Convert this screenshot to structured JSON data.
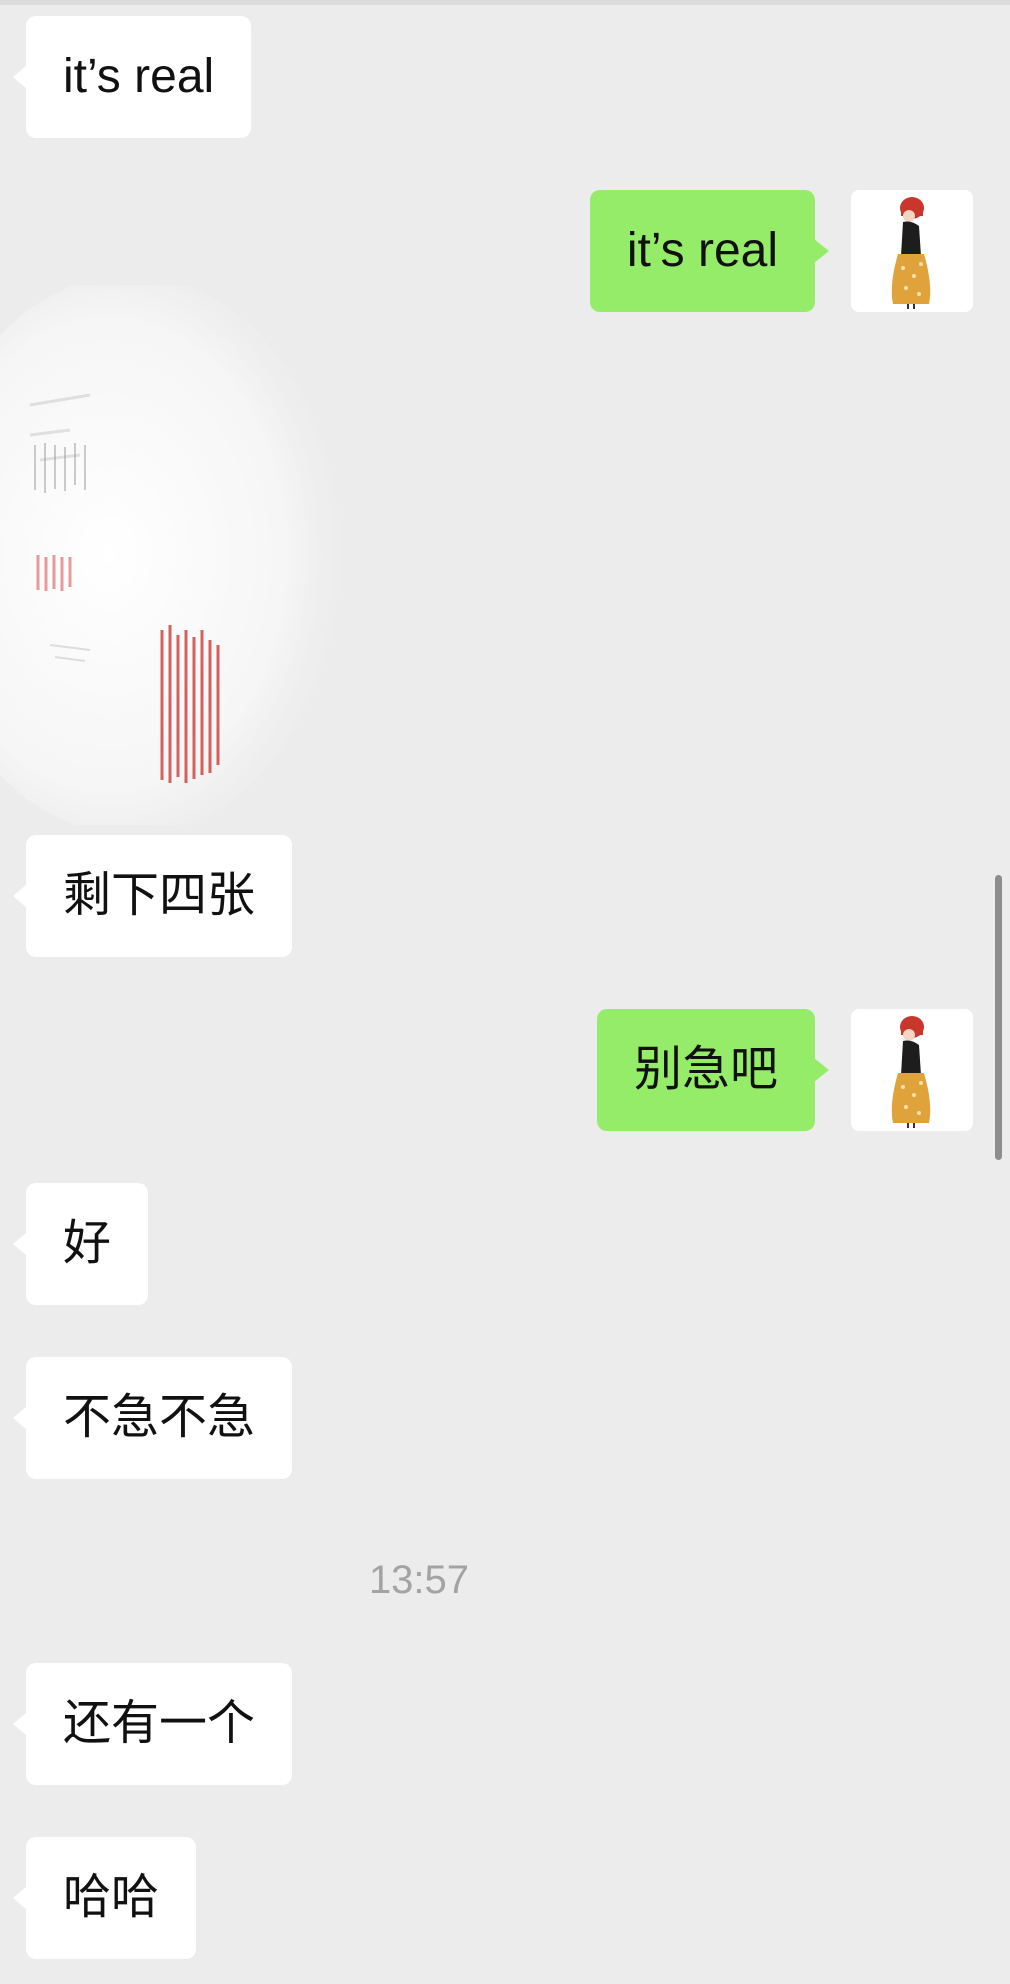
{
  "chat": {
    "messages": [
      {
        "side": "in",
        "text": "it’s real"
      },
      {
        "side": "out",
        "text": "it’s real"
      },
      {
        "side": "in",
        "type": "image",
        "description": "sketch"
      },
      {
        "side": "in",
        "text": "剩下四张"
      },
      {
        "side": "out",
        "text": "别急吧"
      },
      {
        "side": "in",
        "text": "好"
      },
      {
        "side": "in",
        "text": "不急不急"
      },
      {
        "type": "time",
        "text": "13:57"
      },
      {
        "side": "in",
        "text": "还有一个"
      },
      {
        "side": "in",
        "text": "哈哈"
      }
    ]
  },
  "colors": {
    "background": "#ececec",
    "incoming_bubble": "#ffffff",
    "outgoing_bubble": "#95ec69",
    "timestamp": "#a3a3a3"
  },
  "icons": {
    "avatar": "girl-red-hat-avatar-icon"
  }
}
